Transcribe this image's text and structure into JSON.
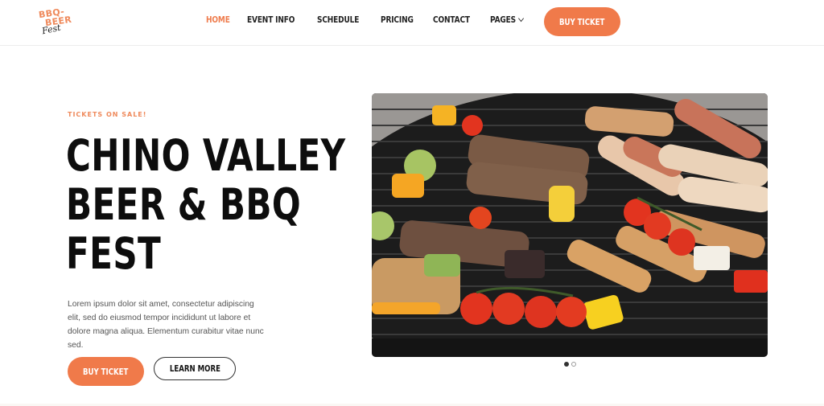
{
  "header": {
    "logo": {
      "line1": "BBQ-",
      "line2": "BEER",
      "line3": "Fest"
    },
    "nav": [
      {
        "label": "HOME",
        "active": true
      },
      {
        "label": "EVENT INFO",
        "active": false
      },
      {
        "label": "SCHEDULE",
        "active": false
      },
      {
        "label": "PRICING",
        "active": false
      },
      {
        "label": "CONTACT",
        "active": false
      },
      {
        "label": "PAGES",
        "active": false,
        "has_dropdown": true
      }
    ],
    "cta_label": "BUY TICKET"
  },
  "hero": {
    "eyebrow": "TICKETS ON SALE!",
    "title_lines": [
      "CHINO VALLEY",
      "BEER & BBQ",
      "FEST"
    ],
    "description": "Lorem ipsum dolor sit amet, consectetur adipiscing elit, sed do eiusmod tempor incididunt ut labore et dolore magna aliqua. Elementum curabitur vitae nunc sed.",
    "primary_button": "BUY TICKET",
    "secondary_button": "LEARN MORE",
    "image_alt": "BBQ grill with skewers, sausages, steaks and vegetables",
    "slider": {
      "total": 2,
      "current": 1
    }
  },
  "colors": {
    "accent": "#f07a4a",
    "text_dark": "#0d0d0d",
    "text_muted": "#555555"
  }
}
